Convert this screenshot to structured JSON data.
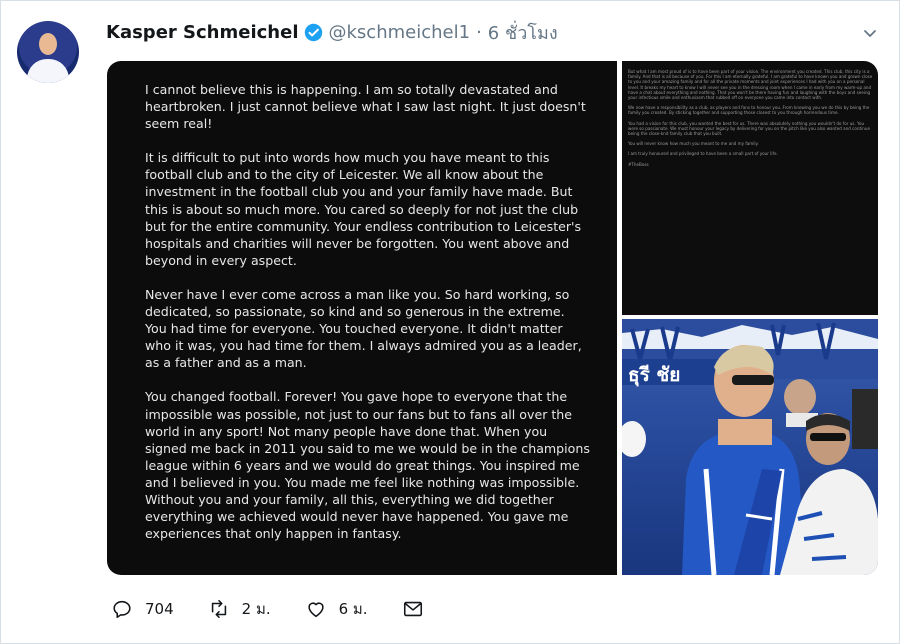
{
  "tweet": {
    "display_name": "Kasper Schmeichel",
    "handle": "@kschmeichel1",
    "separator": "·",
    "time": "6 ชั่วโมง"
  },
  "letter": {
    "paragraphs": [
      "I cannot believe this is happening. I am so totally devastated and heartbroken. I just cannot believe what I saw last night. It just doesn't seem real!",
      "It is difficult to put into words how much you have meant to this football club and to the city of Leicester. We all know about the investment in the football club you and your family have made. But this is about so much more. You cared so deeply for not just the club but for the entire community. Your endless contribution to Leicester's hospitals and charities will never be forgotten. You went above and beyond in every aspect.",
      "Never have I ever come across a man like you. So hard working, so dedicated, so passionate, so kind and so generous in the extreme. You had time for everyone. You touched everyone. It didn't matter who it was, you had time for them. I always admired you as a leader, as a father and as a man.",
      "You changed football. Forever! You gave hope to everyone that the impossible was possible, not just to our fans but to fans all over the world in any sport! Not many people have done that. When you signed me back in 2011 you said to me we would be in the champions league within 6 years and we would do great things. You inspired me and I believed in you. You made me feel like nothing was impossible. Without you and your family, all this, everything we did together everything we achieved would never have happened. You gave me experiences that only happen in fantasy."
    ]
  },
  "letter_continued": {
    "paragraphs": [
      "But what I am most proud of is to have been part of your vision. The environment you created. This club, this city is a family. And that is all because of you. For this I am eternally grateful. I am grateful to have known you and grown close to you and your amazing family and for all the private moments and joint experiences I had with you on a personal level. It breaks my heart to know I will never see you in the dressing room when I came in early from my warm-up and have a chat about everything and nothing. That you won't be there having fun and laughing with the boys and seeing your infectious smile and enthusiasm that rubbed off on everyone you came into contact with.",
      "We now have a responsibility as a club, as players and fans to honour you. From knowing you we do this by being the family you created. By sticking together and supporting those closest to you through horrendous time.",
      "You had a vision for this club, you wanted the best for us. There was absolutely nothing you wouldn't do for us. You were so passionate. We must honour your legacy by delivering for you on the pitch like you also wanted and continue being the close-knit family club that you built.",
      "You will never know how much you meant to me and my family.",
      "I am truly honoured and privileged to have been a small part of your life.",
      "#TheBoss"
    ]
  },
  "photo": {
    "banner_text": "ธุรี ชัย"
  },
  "actions": {
    "replies": "704",
    "retweets": "2 ม.",
    "likes": "6 ม."
  },
  "colors": {
    "accent": "#1da1f2",
    "text": "#14171a",
    "muted": "#657786"
  },
  "icons": [
    "verified-badge-icon",
    "chevron-down-icon",
    "reply-icon",
    "retweet-icon",
    "like-icon",
    "direct-message-icon"
  ]
}
